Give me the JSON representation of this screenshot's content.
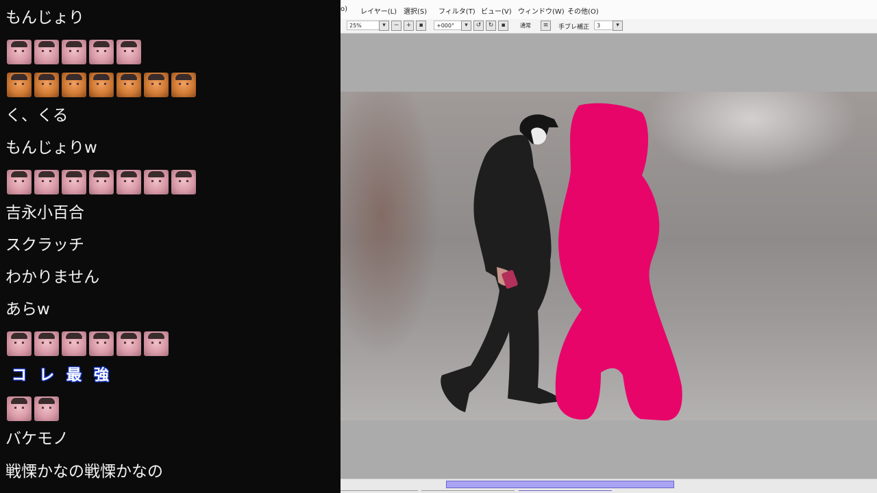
{
  "chat": {
    "lines": [
      "もんじょり",
      "く、くる",
      "もんじょりw",
      "吉永小百合",
      "スクラッチ",
      "わかりません",
      "あらw",
      "バケモノ",
      "戦慄かなの戦慄かなの"
    ],
    "stamps": [
      "コ",
      "レ",
      "最",
      "強"
    ],
    "colors": {
      "background": "#0b0b0b",
      "text": "#f2f2f2",
      "stamp_outline": "#1c3fd8"
    }
  },
  "app": {
    "menu": [
      "o)",
      "レイヤー(L)",
      "選択(S)",
      "フィルタ(T)",
      "ビュー(V)",
      "ウィンドウ(W)",
      "その他(O)"
    ],
    "toolbar": {
      "zoom_value": "25%",
      "rotation_value": "+000°",
      "blend_mode": "通常",
      "stabilizer_label": "手ブレ補正",
      "stabilizer_value": "3"
    },
    "colors": {
      "paint": "#e8056a",
      "scroll_thumb": "#a9a3f4",
      "workspace": "#ababab"
    }
  }
}
